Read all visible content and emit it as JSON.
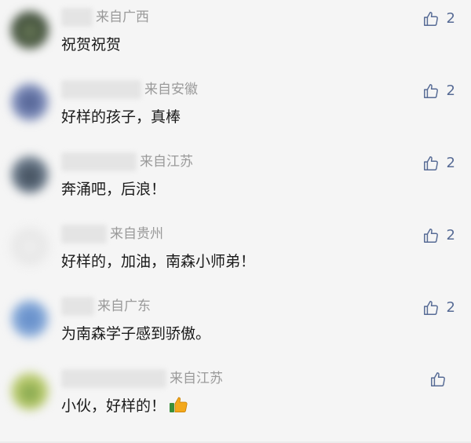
{
  "comments": [
    {
      "location": "来自广西",
      "text": "祝贺祝贺",
      "likes": "2"
    },
    {
      "location": "来自安徽",
      "text": "好样的孩子，真棒",
      "likes": "2"
    },
    {
      "location": "来自江苏",
      "text": "奔涌吧，后浪！",
      "likes": "2"
    },
    {
      "location": "来自贵州",
      "text": "好样的，加油，南森小师弟！",
      "likes": "2"
    },
    {
      "location": "来自广东",
      "text": "为南森学子感到骄傲。",
      "likes": "2"
    },
    {
      "location": "来自江苏",
      "text": "小伙，好样的！",
      "likes": ""
    }
  ],
  "icons": {
    "like": "thumbs-up-icon",
    "emoji": "thumbs-up-emoji-icon"
  },
  "colors": {
    "like": "#576b95",
    "location": "#9a9a9a",
    "text": "#1a1a1a",
    "background": "#f5f5f5"
  }
}
